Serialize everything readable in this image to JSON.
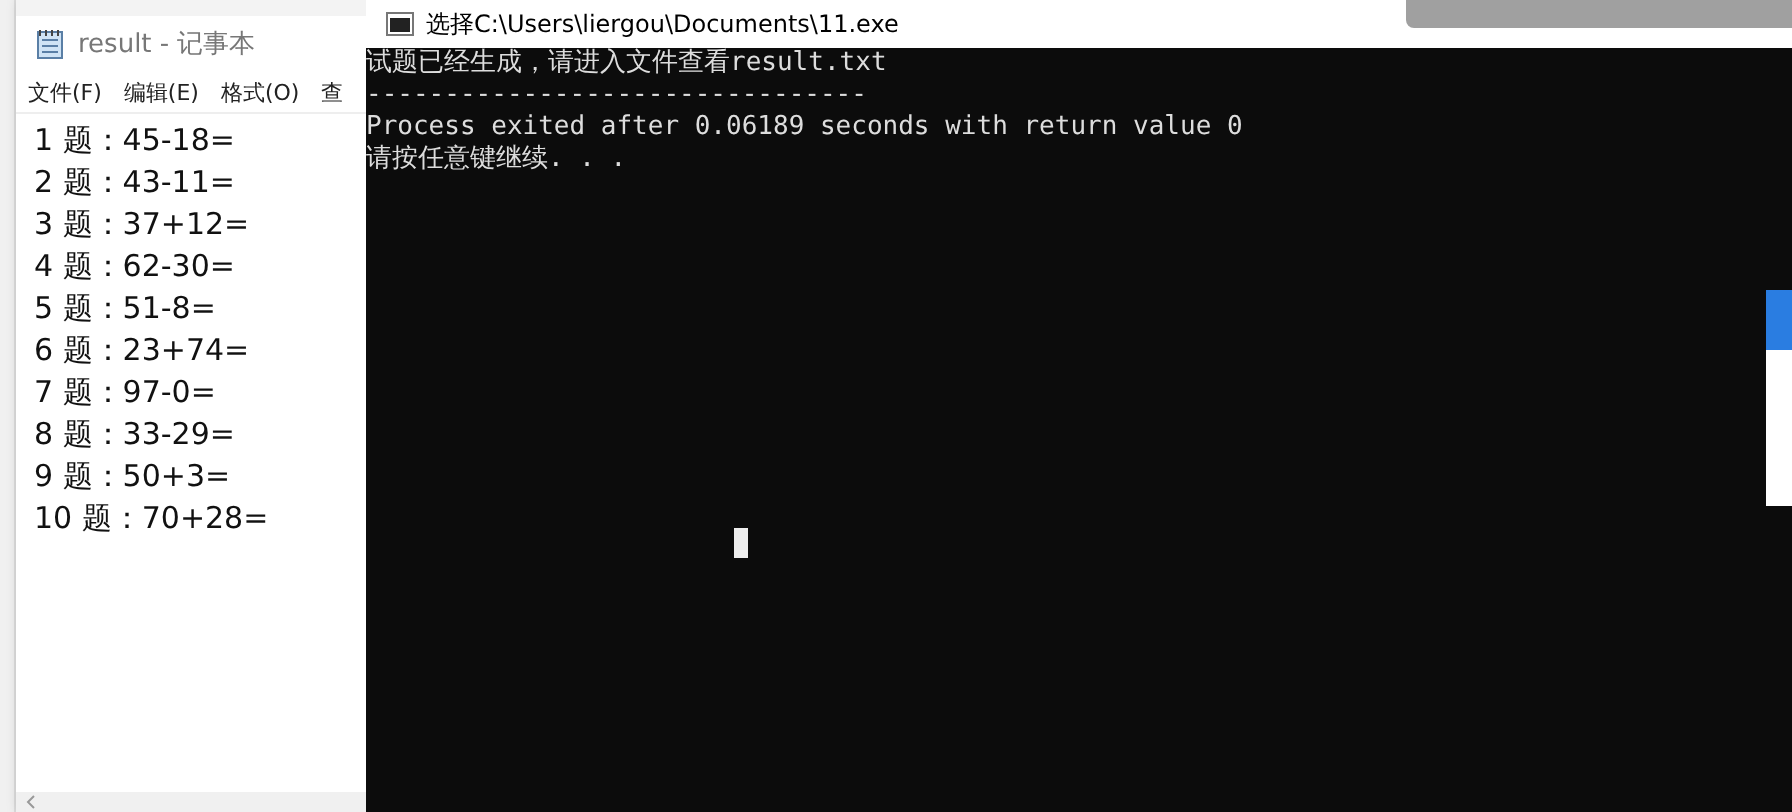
{
  "notepad": {
    "title": "result - 记事本",
    "menu": [
      {
        "label": "文件(F)"
      },
      {
        "label": "编辑(E)"
      },
      {
        "label": "格式(O)"
      },
      {
        "label": "查"
      }
    ],
    "lines": [
      "1 题：45-18=",
      "2 题：43-11=",
      "3 题：37+12=",
      "4 题：62-30=",
      "5 题：51-8=",
      "6 题：23+74=",
      "7 题：97-0=",
      "8 题：33-29=",
      "9 题：50+3=",
      "10 题：70+28="
    ]
  },
  "console": {
    "title": "选择C:\\Users\\liergou\\Documents\\11.exe",
    "lines": [
      "试题已经生成，请进入文件查看result.txt",
      "--------------------------------",
      "Process exited after 0.06189 seconds with return value 0",
      "请按任意键继续. . ."
    ]
  }
}
